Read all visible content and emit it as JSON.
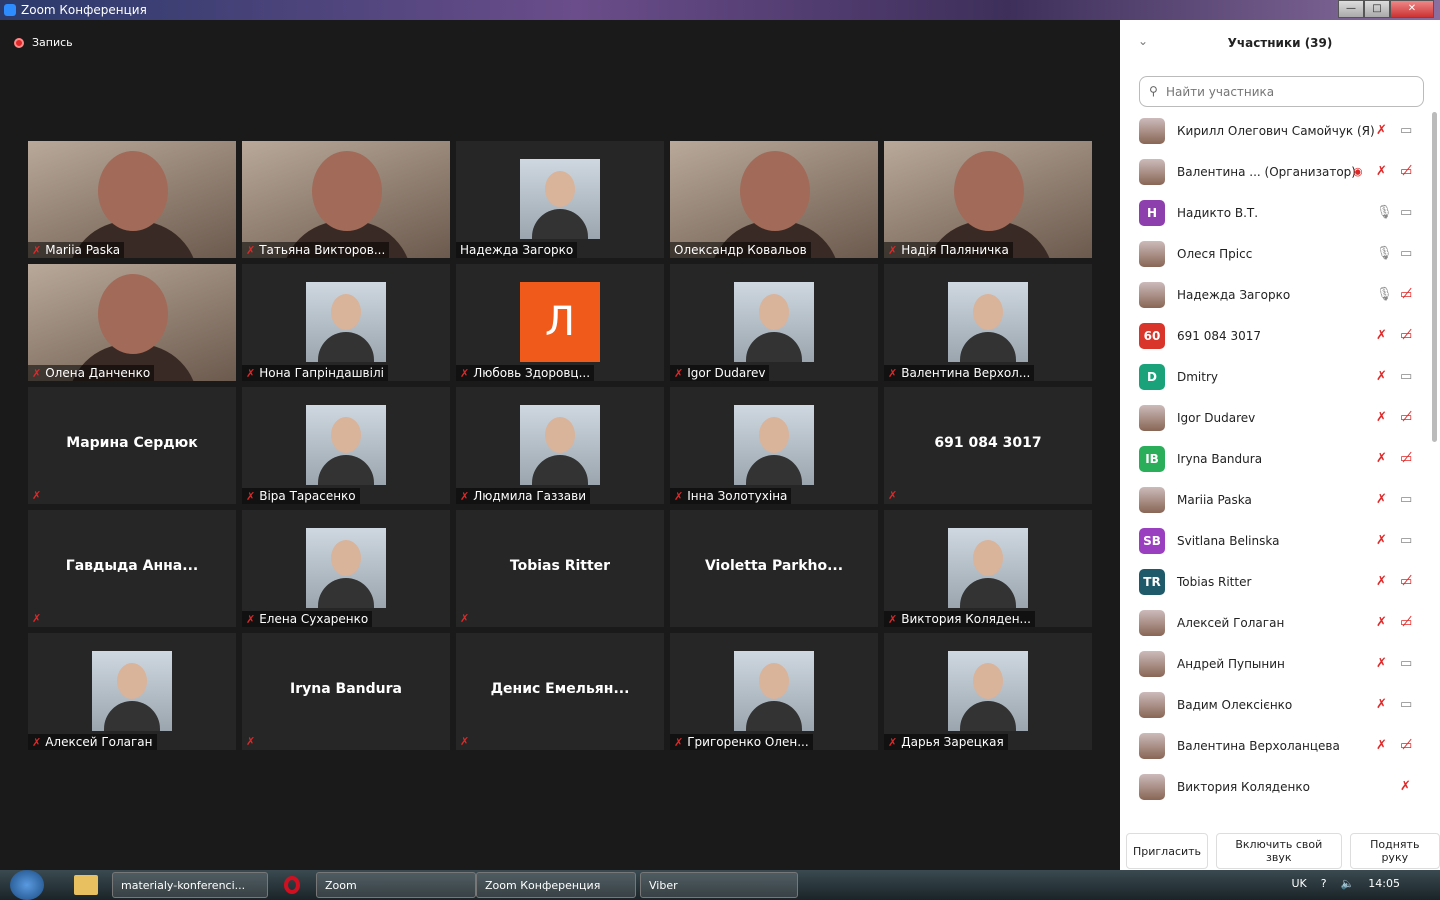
{
  "window": {
    "title": "Zoom Конференция",
    "minimize": "—",
    "maximize": "□",
    "close": "✕"
  },
  "recording": {
    "label": "Запись"
  },
  "tiles": [
    {
      "name": "Mariia Paska",
      "kind": "video",
      "muted": true
    },
    {
      "name": "Татьяна Викторов...",
      "kind": "video",
      "muted": true
    },
    {
      "name": "Надежда Загорко",
      "kind": "photo",
      "muted": false
    },
    {
      "name": "Олександр Ковальов",
      "kind": "video",
      "muted": false
    },
    {
      "name": "Надія Паляничка",
      "kind": "video",
      "muted": true
    },
    {
      "name": "Олена Данченко",
      "kind": "video",
      "muted": true
    },
    {
      "name": "Нона Гапріндашвілі",
      "kind": "photo",
      "muted": true
    },
    {
      "name": "Любовь Здоровц...",
      "kind": "letter",
      "letter": "Л",
      "muted": true
    },
    {
      "name": "Igor Dudarev",
      "kind": "photo",
      "muted": true
    },
    {
      "name": "Валентина Верхол...",
      "kind": "photo",
      "muted": true
    },
    {
      "name": "Марина Сердюк",
      "kind": "name",
      "muted": true
    },
    {
      "name": "Віра Тарасенко",
      "kind": "photo",
      "muted": true
    },
    {
      "name": "Людмила Газзави",
      "kind": "photo",
      "muted": true
    },
    {
      "name": "Інна Золотухіна",
      "kind": "photo",
      "muted": true
    },
    {
      "name": "691 084 3017",
      "kind": "name",
      "muted": true
    },
    {
      "name": "Гавдыда  Анна...",
      "kind": "name",
      "muted": true
    },
    {
      "name": "Елена Сухаренко",
      "kind": "photo",
      "muted": true
    },
    {
      "name": "Tobias Ritter",
      "kind": "name",
      "muted": true
    },
    {
      "name": "Violetta  Parkho...",
      "kind": "name",
      "muted": false
    },
    {
      "name": "Виктория Колядeн...",
      "kind": "photo",
      "muted": true
    },
    {
      "name": "Алексей Голаган",
      "kind": "photo",
      "muted": true
    },
    {
      "name": "Iryna Bandura",
      "kind": "name",
      "muted": true
    },
    {
      "name": "Денис  Емельян...",
      "kind": "name",
      "muted": true
    },
    {
      "name": "Григоренко Олен...",
      "kind": "photo",
      "muted": true
    },
    {
      "name": "Дарья Зарецкая",
      "kind": "photo",
      "muted": true
    }
  ],
  "panel": {
    "title": "Участники (39)",
    "search_placeholder": "Найти участника",
    "participants": [
      {
        "name": "Кирилл Олегович Самойчук (Я)",
        "mic": "off",
        "cam": "on"
      },
      {
        "name": "Валентина ...   (Организатор)",
        "mic": "off",
        "cam": "off",
        "rec": true
      },
      {
        "name": "Надикто В.Т.",
        "initials": "H",
        "color": "#8e3fae",
        "mic": "on",
        "cam": "on"
      },
      {
        "name": "Олеся Прісс",
        "mic": "on",
        "cam": "on"
      },
      {
        "name": "Надежда Загорко",
        "mic": "on",
        "cam": "off"
      },
      {
        "name": "691 084 3017",
        "initials": "60",
        "color": "#d9352a",
        "mic": "off",
        "cam": "off"
      },
      {
        "name": "Dmitry",
        "initials": "D",
        "color": "#1aa37a",
        "mic": "off",
        "cam": "on"
      },
      {
        "name": "Igor Dudarev",
        "mic": "off",
        "cam": "off"
      },
      {
        "name": "Iryna Bandura",
        "initials": "IB",
        "color": "#2aae5a",
        "mic": "off",
        "cam": "off"
      },
      {
        "name": "Mariia Paska",
        "mic": "off",
        "cam": "on"
      },
      {
        "name": "Svitlana Belinska",
        "initials": "SB",
        "color": "#9a3fc0",
        "mic": "off",
        "cam": "on"
      },
      {
        "name": "Tobias Ritter",
        "initials": "TR",
        "color": "#1f5a6a",
        "mic": "off",
        "cam": "off"
      },
      {
        "name": "Алексей Голаган",
        "mic": "off",
        "cam": "off"
      },
      {
        "name": "Андрей Пупынин",
        "mic": "off",
        "cam": "on"
      },
      {
        "name": "Вадим Олексієнко",
        "mic": "off",
        "cam": "on"
      },
      {
        "name": "Валентина Верхоланцева",
        "mic": "off",
        "cam": "off"
      },
      {
        "name": "Виктория Коляденко",
        "mic": "off",
        "cam": "none"
      }
    ],
    "buttons": {
      "invite": "Пригласить",
      "unmute": "Включить свой звук",
      "raise_hand": "Поднять руку"
    }
  },
  "taskbar": {
    "items": [
      "materialy-konferenci...",
      "Zoom",
      "Zoom Конференция",
      "Viber"
    ],
    "lang": "UK",
    "time": "14:05"
  },
  "colors": {
    "muted": "#e02828",
    "accent": "#2d8cff"
  }
}
